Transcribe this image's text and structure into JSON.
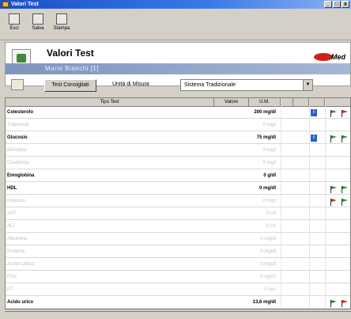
{
  "window": {
    "title": "Valori Test",
    "buttons": [
      "_",
      "□",
      "x"
    ]
  },
  "toolbar": {
    "items": [
      {
        "label": "Esci",
        "icon": "exit-icon"
      },
      {
        "label": "Salva",
        "icon": "save-icon"
      },
      {
        "label": "Stampa",
        "icon": "print-icon"
      }
    ]
  },
  "header": {
    "title": "Valori Test",
    "patient": "Mario Bianchi [1]",
    "logo": "Med"
  },
  "controls": {
    "test_button": "Test Consigliati",
    "units_label": "Unità di Misura",
    "units_value": "Sistema Tradizionale"
  },
  "table": {
    "columns": [
      "Tipo Test",
      "Valore",
      "U.M."
    ],
    "rows": [
      {
        "name": "Colesterolo",
        "value": "200 mg/dl",
        "style": "bold",
        "info": true,
        "flag": "green-red"
      },
      {
        "name": "Trigliceridi",
        "value": "0 mg/l",
        "style": "dim",
        "info": false,
        "flag": ""
      },
      {
        "name": "Glucosio",
        "value": "75 mg/dl",
        "style": "bold",
        "info": true,
        "flag": "green-green"
      },
      {
        "name": "Bilirubina",
        "value": "0 mg/l",
        "style": "dim",
        "info": false,
        "flag": ""
      },
      {
        "name": "Creatinina",
        "value": "0 mg/l",
        "style": "dim",
        "info": false,
        "flag": ""
      },
      {
        "name": "Emoglobina",
        "value": "0 g/dl",
        "style": "bold",
        "info": false,
        "flag": ""
      },
      {
        "name": "HDL",
        "value": "0 mg/dl",
        "style": "bold",
        "info": false,
        "flag": "green-green"
      },
      {
        "name": "Potassio",
        "value": "0 mg/l",
        "style": "dim",
        "info": false,
        "flag": "red-green"
      },
      {
        "name": "AST",
        "value": "0 U/l",
        "style": "dim",
        "info": false,
        "flag": ""
      },
      {
        "name": "ALT",
        "value": "0 U/l",
        "style": "dim",
        "info": false,
        "flag": ""
      },
      {
        "name": "Albumina",
        "value": "0 mg/dl",
        "style": "dim",
        "info": false,
        "flag": ""
      },
      {
        "name": "Proteine",
        "value": "0 mg/dl",
        "style": "dim",
        "info": false,
        "flag": ""
      },
      {
        "name": "Acido Lattico",
        "value": "0 mg/dl",
        "style": "dim",
        "info": false,
        "flag": ""
      },
      {
        "name": "PSA",
        "value": "0 ng/ml",
        "style": "dim",
        "info": false,
        "flag": ""
      },
      {
        "name": "PT",
        "value": "0 sec",
        "style": "dim",
        "info": false,
        "flag": ""
      },
      {
        "name": "Acido urico",
        "value": "13,6 mg/dl",
        "style": "bold",
        "info": false,
        "flag": "green-red"
      }
    ]
  },
  "colors": {
    "title_bar": "#1a4fc9",
    "patient_bar": "#7e95bf",
    "info": "#2c5fc8",
    "flag_green": "#2f8a2a",
    "flag_red": "#d0281e"
  }
}
